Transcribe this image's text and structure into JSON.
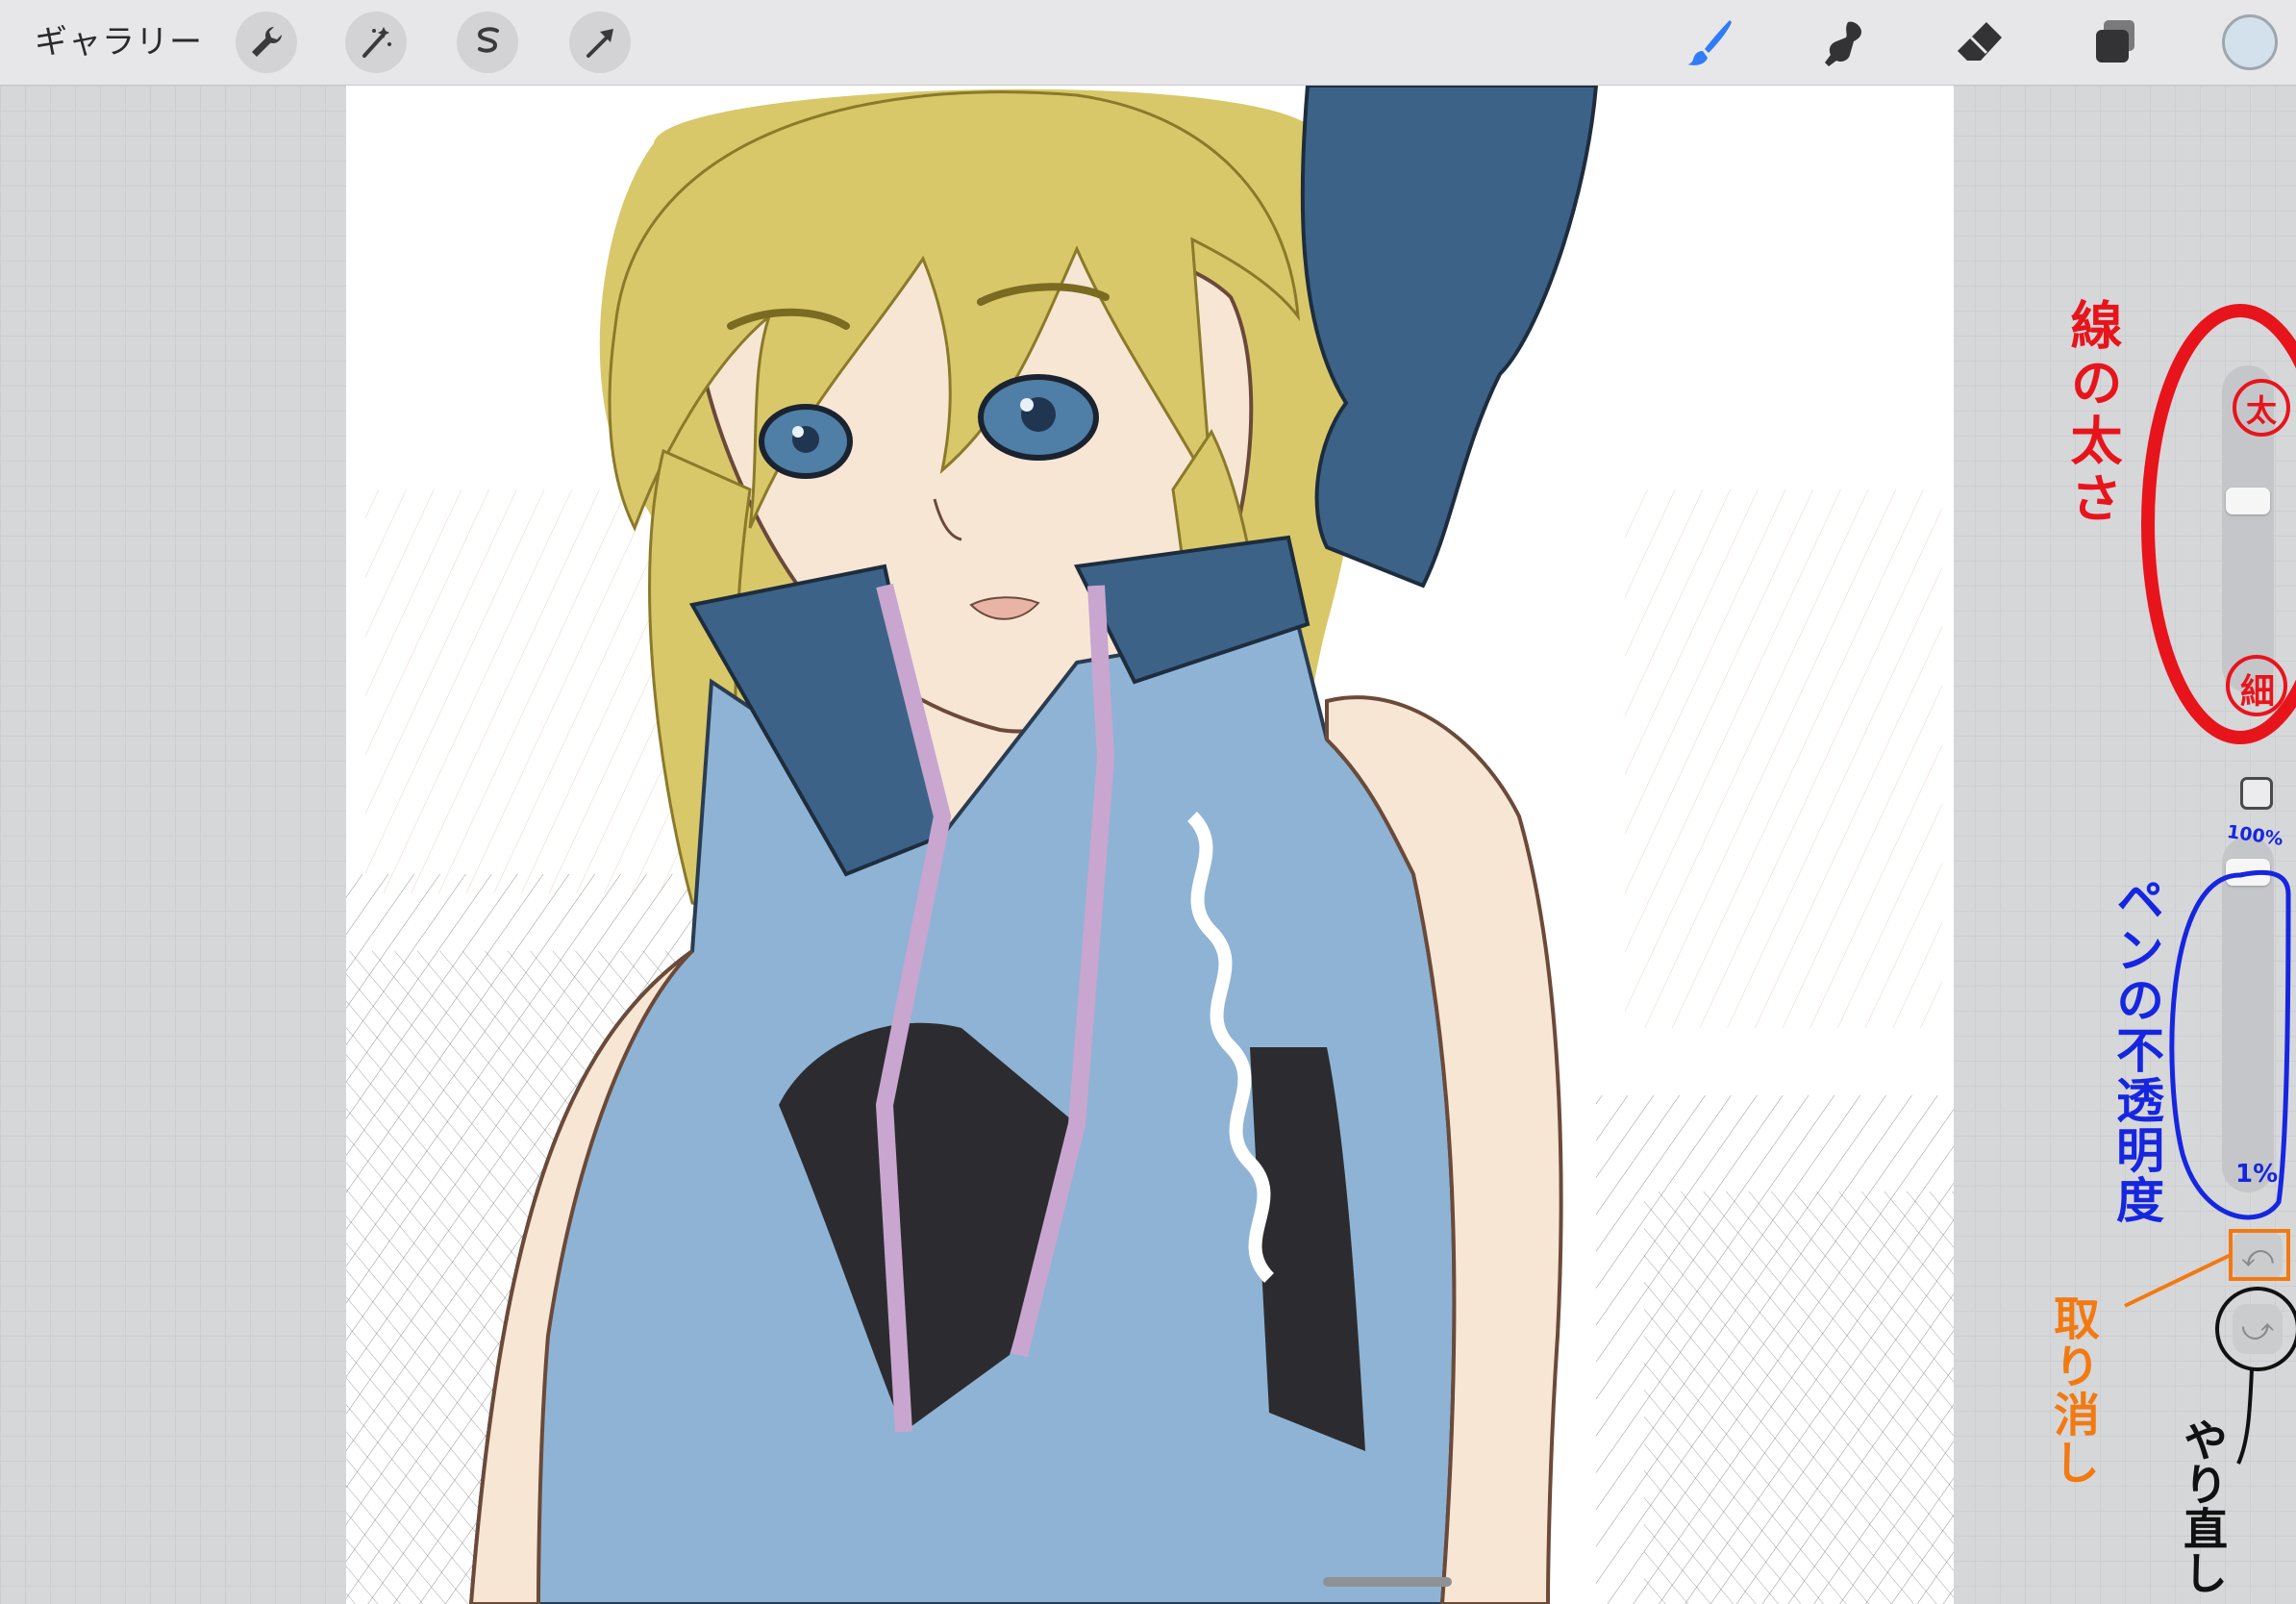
{
  "toolbar": {
    "gallery_label": "ギャラリー",
    "left_tools": [
      "wrench-icon",
      "magic-wand-icon",
      "selection-icon",
      "transform-arrow-icon"
    ],
    "right_tools": [
      "brush-icon",
      "smudge-icon",
      "eraser-icon",
      "layers-icon"
    ],
    "active_tool": "brush-icon",
    "active_tool_color": "#2f7cf6",
    "current_color": "#d3e1ec"
  },
  "sidebar": {
    "brush_size_level": 0.6,
    "opacity_level": 0.96
  },
  "annotations": {
    "line_width": "線の太さ",
    "thick": "太",
    "thin": "細",
    "opacity_pct_top": "100%",
    "pen_opacity": "ペンの不透明度",
    "opacity_pct_bottom": "1%",
    "undo": "取り消し",
    "redo": "やり直し",
    "colors": {
      "line_width": "#e8141c",
      "opacity": "#1626e0",
      "undo": "#f27a12",
      "redo": "#111111"
    }
  },
  "canvas": {
    "palette": {
      "hair": "#d8c86a",
      "skin": "#f8e6d4",
      "dress": "#8fb3d4",
      "ribbon": "#3c6288",
      "eyes": "#4f7ea6",
      "inner": "#2c2c30",
      "trim": "#c9a6cf"
    }
  }
}
